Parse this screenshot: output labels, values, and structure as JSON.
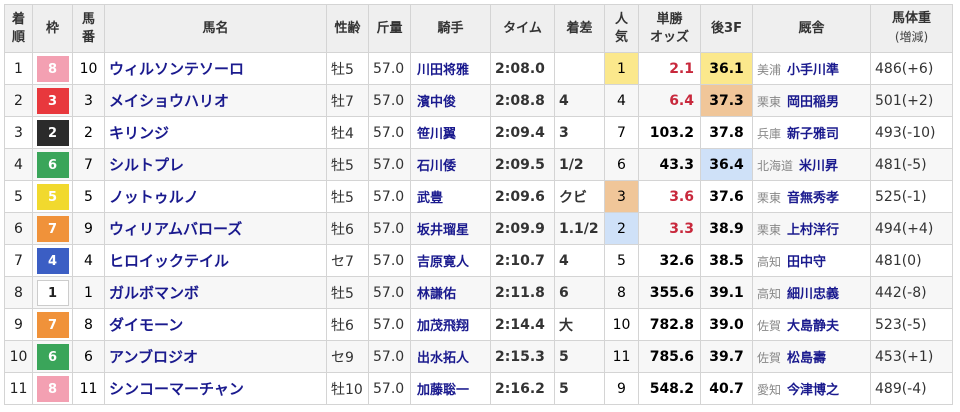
{
  "headers": {
    "rank": [
      "着",
      "順"
    ],
    "waku": "枠",
    "num": [
      "馬",
      "番"
    ],
    "horse": "馬名",
    "sexage": "性齢",
    "weight": "斤量",
    "jockey": "騎手",
    "time": "タイム",
    "margin": "着差",
    "pop": [
      "人",
      "気"
    ],
    "odds": [
      "単勝",
      "オッズ"
    ],
    "last3f": "後3F",
    "stable": "厩舎",
    "bw": [
      "馬体重",
      "(増減)"
    ]
  },
  "colors": {
    "waku": {
      "1": {
        "bg": "#ffffff",
        "fg": "#222222",
        "border": "#cccccc"
      },
      "2": {
        "bg": "#2b2b2b",
        "fg": "#ffffff",
        "border": "#2b2b2b"
      },
      "3": {
        "bg": "#e8383d",
        "fg": "#ffffff",
        "border": "#e8383d"
      },
      "4": {
        "bg": "#3b5ec4",
        "fg": "#ffffff",
        "border": "#3b5ec4"
      },
      "5": {
        "bg": "#f1d92e",
        "fg": "#ffffff",
        "border": "#f1d92e"
      },
      "6": {
        "bg": "#3aa55a",
        "fg": "#ffffff",
        "border": "#3aa55a"
      },
      "7": {
        "bg": "#f0923a",
        "fg": "#ffffff",
        "border": "#f0923a"
      },
      "8": {
        "bg": "#f3a0b2",
        "fg": "#ffffff",
        "border": "#f3a0b2"
      }
    },
    "odds_highlight": "#c8283c",
    "highlight_first": "#fbe88c",
    "highlight_second": "#f0c699",
    "highlight_third": "#cfe1f8"
  },
  "rows": [
    {
      "rank": "1",
      "waku": "8",
      "num": "10",
      "horse": "ウィルソンテソーロ",
      "sexage": "牡5",
      "weight": "57.0",
      "jockey": "川田将雅",
      "time": "2:08.0",
      "margin": "",
      "pop": "1",
      "odds": "2.1",
      "last3f": "36.1",
      "region": "美浦",
      "trainer": "小手川準",
      "bw": "486(+6)",
      "pop_hl": "yellow",
      "l3f_hl": "yellow",
      "odds_red": true
    },
    {
      "rank": "2",
      "waku": "3",
      "num": "3",
      "horse": "メイショウハリオ",
      "sexage": "牡7",
      "weight": "57.0",
      "jockey": "濱中俊",
      "time": "2:08.8",
      "margin": "4",
      "pop": "4",
      "odds": "6.4",
      "last3f": "37.3",
      "region": "栗東",
      "trainer": "岡田稲男",
      "bw": "501(+2)",
      "pop_hl": "",
      "l3f_hl": "tan",
      "odds_red": true
    },
    {
      "rank": "3",
      "waku": "2",
      "num": "2",
      "horse": "キリンジ",
      "sexage": "牡4",
      "weight": "57.0",
      "jockey": "笹川翼",
      "time": "2:09.4",
      "margin": "3",
      "pop": "7",
      "odds": "103.2",
      "last3f": "37.8",
      "region": "兵庫",
      "trainer": "新子雅司",
      "bw": "493(-10)",
      "pop_hl": "",
      "l3f_hl": "",
      "odds_red": false
    },
    {
      "rank": "4",
      "waku": "6",
      "num": "7",
      "horse": "シルトプレ",
      "sexage": "牡5",
      "weight": "57.0",
      "jockey": "石川倭",
      "time": "2:09.5",
      "margin": "1/2",
      "pop": "6",
      "odds": "43.3",
      "last3f": "36.4",
      "region": "北海道",
      "trainer": "米川昇",
      "bw": "481(-5)",
      "pop_hl": "",
      "l3f_hl": "blue",
      "odds_red": false
    },
    {
      "rank": "5",
      "waku": "5",
      "num": "5",
      "horse": "ノットゥルノ",
      "sexage": "牡5",
      "weight": "57.0",
      "jockey": "武豊",
      "time": "2:09.6",
      "margin": "クビ",
      "pop": "3",
      "odds": "3.6",
      "last3f": "37.6",
      "region": "栗東",
      "trainer": "音無秀孝",
      "bw": "525(-1)",
      "pop_hl": "tan",
      "l3f_hl": "",
      "odds_red": true
    },
    {
      "rank": "6",
      "waku": "7",
      "num": "9",
      "horse": "ウィリアムバローズ",
      "sexage": "牡6",
      "weight": "57.0",
      "jockey": "坂井瑠星",
      "time": "2:09.9",
      "margin": "1.1/2",
      "pop": "2",
      "odds": "3.3",
      "last3f": "38.9",
      "region": "栗東",
      "trainer": "上村洋行",
      "bw": "494(+4)",
      "pop_hl": "blue",
      "l3f_hl": "",
      "odds_red": true
    },
    {
      "rank": "7",
      "waku": "4",
      "num": "4",
      "horse": "ヒロイックテイル",
      "sexage": "セ7",
      "weight": "57.0",
      "jockey": "吉原寛人",
      "time": "2:10.7",
      "margin": "4",
      "pop": "5",
      "odds": "32.6",
      "last3f": "38.5",
      "region": "高知",
      "trainer": "田中守",
      "bw": "481(0)",
      "pop_hl": "",
      "l3f_hl": "",
      "odds_red": false
    },
    {
      "rank": "8",
      "waku": "1",
      "num": "1",
      "horse": "ガルボマンボ",
      "sexage": "牡5",
      "weight": "57.0",
      "jockey": "林謙佑",
      "time": "2:11.8",
      "margin": "6",
      "pop": "8",
      "odds": "355.6",
      "last3f": "39.1",
      "region": "高知",
      "trainer": "細川忠義",
      "bw": "442(-8)",
      "pop_hl": "",
      "l3f_hl": "",
      "odds_red": false
    },
    {
      "rank": "9",
      "waku": "7",
      "num": "8",
      "horse": "ダイモーン",
      "sexage": "牡6",
      "weight": "57.0",
      "jockey": "加茂飛翔",
      "time": "2:14.4",
      "margin": "大",
      "pop": "10",
      "odds": "782.8",
      "last3f": "39.0",
      "region": "佐賀",
      "trainer": "大島静夫",
      "bw": "523(-5)",
      "pop_hl": "",
      "l3f_hl": "",
      "odds_red": false
    },
    {
      "rank": "10",
      "waku": "6",
      "num": "6",
      "horse": "アンブロジオ",
      "sexage": "セ9",
      "weight": "57.0",
      "jockey": "出水拓人",
      "time": "2:15.3",
      "margin": "5",
      "pop": "11",
      "odds": "785.6",
      "last3f": "39.7",
      "region": "佐賀",
      "trainer": "松島壽",
      "bw": "453(+1)",
      "pop_hl": "",
      "l3f_hl": "",
      "odds_red": false
    },
    {
      "rank": "11",
      "waku": "8",
      "num": "11",
      "horse": "シンコーマーチャン",
      "sexage": "牡10",
      "weight": "57.0",
      "jockey": "加藤聡一",
      "time": "2:16.2",
      "margin": "5",
      "pop": "9",
      "odds": "548.2",
      "last3f": "40.7",
      "region": "愛知",
      "trainer": "今津博之",
      "bw": "489(-4)",
      "pop_hl": "",
      "l3f_hl": "",
      "odds_red": false
    }
  ]
}
